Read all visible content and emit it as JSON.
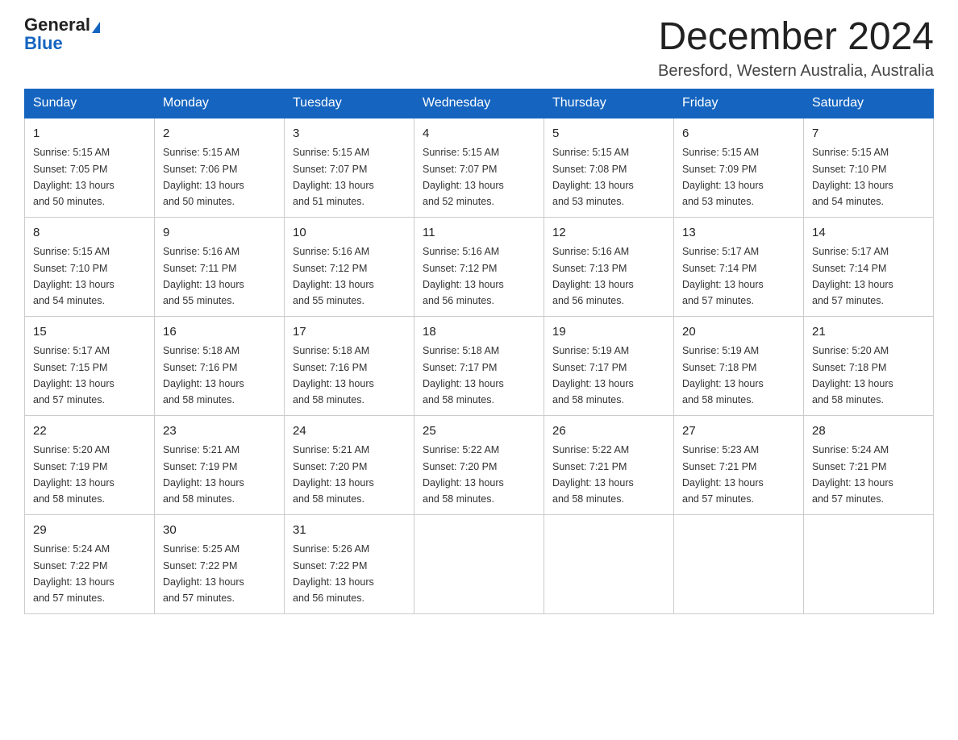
{
  "header": {
    "logo_general": "General",
    "logo_blue": "Blue",
    "month_title": "December 2024",
    "location": "Beresford, Western Australia, Australia"
  },
  "days_of_week": [
    "Sunday",
    "Monday",
    "Tuesday",
    "Wednesday",
    "Thursday",
    "Friday",
    "Saturday"
  ],
  "weeks": [
    [
      {
        "day": "1",
        "sunrise": "5:15 AM",
        "sunset": "7:05 PM",
        "daylight": "13 hours and 50 minutes."
      },
      {
        "day": "2",
        "sunrise": "5:15 AM",
        "sunset": "7:06 PM",
        "daylight": "13 hours and 50 minutes."
      },
      {
        "day": "3",
        "sunrise": "5:15 AM",
        "sunset": "7:07 PM",
        "daylight": "13 hours and 51 minutes."
      },
      {
        "day": "4",
        "sunrise": "5:15 AM",
        "sunset": "7:07 PM",
        "daylight": "13 hours and 52 minutes."
      },
      {
        "day": "5",
        "sunrise": "5:15 AM",
        "sunset": "7:08 PM",
        "daylight": "13 hours and 53 minutes."
      },
      {
        "day": "6",
        "sunrise": "5:15 AM",
        "sunset": "7:09 PM",
        "daylight": "13 hours and 53 minutes."
      },
      {
        "day": "7",
        "sunrise": "5:15 AM",
        "sunset": "7:10 PM",
        "daylight": "13 hours and 54 minutes."
      }
    ],
    [
      {
        "day": "8",
        "sunrise": "5:15 AM",
        "sunset": "7:10 PM",
        "daylight": "13 hours and 54 minutes."
      },
      {
        "day": "9",
        "sunrise": "5:16 AM",
        "sunset": "7:11 PM",
        "daylight": "13 hours and 55 minutes."
      },
      {
        "day": "10",
        "sunrise": "5:16 AM",
        "sunset": "7:12 PM",
        "daylight": "13 hours and 55 minutes."
      },
      {
        "day": "11",
        "sunrise": "5:16 AM",
        "sunset": "7:12 PM",
        "daylight": "13 hours and 56 minutes."
      },
      {
        "day": "12",
        "sunrise": "5:16 AM",
        "sunset": "7:13 PM",
        "daylight": "13 hours and 56 minutes."
      },
      {
        "day": "13",
        "sunrise": "5:17 AM",
        "sunset": "7:14 PM",
        "daylight": "13 hours and 57 minutes."
      },
      {
        "day": "14",
        "sunrise": "5:17 AM",
        "sunset": "7:14 PM",
        "daylight": "13 hours and 57 minutes."
      }
    ],
    [
      {
        "day": "15",
        "sunrise": "5:17 AM",
        "sunset": "7:15 PM",
        "daylight": "13 hours and 57 minutes."
      },
      {
        "day": "16",
        "sunrise": "5:18 AM",
        "sunset": "7:16 PM",
        "daylight": "13 hours and 58 minutes."
      },
      {
        "day": "17",
        "sunrise": "5:18 AM",
        "sunset": "7:16 PM",
        "daylight": "13 hours and 58 minutes."
      },
      {
        "day": "18",
        "sunrise": "5:18 AM",
        "sunset": "7:17 PM",
        "daylight": "13 hours and 58 minutes."
      },
      {
        "day": "19",
        "sunrise": "5:19 AM",
        "sunset": "7:17 PM",
        "daylight": "13 hours and 58 minutes."
      },
      {
        "day": "20",
        "sunrise": "5:19 AM",
        "sunset": "7:18 PM",
        "daylight": "13 hours and 58 minutes."
      },
      {
        "day": "21",
        "sunrise": "5:20 AM",
        "sunset": "7:18 PM",
        "daylight": "13 hours and 58 minutes."
      }
    ],
    [
      {
        "day": "22",
        "sunrise": "5:20 AM",
        "sunset": "7:19 PM",
        "daylight": "13 hours and 58 minutes."
      },
      {
        "day": "23",
        "sunrise": "5:21 AM",
        "sunset": "7:19 PM",
        "daylight": "13 hours and 58 minutes."
      },
      {
        "day": "24",
        "sunrise": "5:21 AM",
        "sunset": "7:20 PM",
        "daylight": "13 hours and 58 minutes."
      },
      {
        "day": "25",
        "sunrise": "5:22 AM",
        "sunset": "7:20 PM",
        "daylight": "13 hours and 58 minutes."
      },
      {
        "day": "26",
        "sunrise": "5:22 AM",
        "sunset": "7:21 PM",
        "daylight": "13 hours and 58 minutes."
      },
      {
        "day": "27",
        "sunrise": "5:23 AM",
        "sunset": "7:21 PM",
        "daylight": "13 hours and 57 minutes."
      },
      {
        "day": "28",
        "sunrise": "5:24 AM",
        "sunset": "7:21 PM",
        "daylight": "13 hours and 57 minutes."
      }
    ],
    [
      {
        "day": "29",
        "sunrise": "5:24 AM",
        "sunset": "7:22 PM",
        "daylight": "13 hours and 57 minutes."
      },
      {
        "day": "30",
        "sunrise": "5:25 AM",
        "sunset": "7:22 PM",
        "daylight": "13 hours and 57 minutes."
      },
      {
        "day": "31",
        "sunrise": "5:26 AM",
        "sunset": "7:22 PM",
        "daylight": "13 hours and 56 minutes."
      },
      null,
      null,
      null,
      null
    ]
  ],
  "labels": {
    "sunrise": "Sunrise:",
    "sunset": "Sunset:",
    "daylight": "Daylight:"
  }
}
